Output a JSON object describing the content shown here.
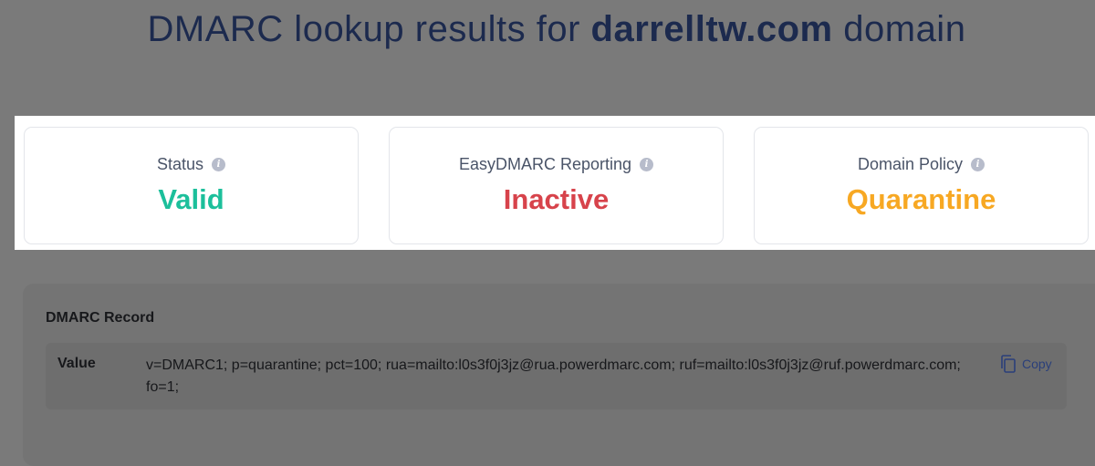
{
  "header": {
    "title_prefix": "DMARC lookup results for",
    "domain": "darrelltw.com",
    "title_suffix": "domain"
  },
  "cards": [
    {
      "label": "Status",
      "value": "Valid",
      "color": "#1cbf9b"
    },
    {
      "label": "EasyDMARC Reporting",
      "value": "Inactive",
      "color": "#d7434b"
    },
    {
      "label": "Domain Policy",
      "value": "Quarantine",
      "color": "#f7a823"
    }
  ],
  "record": {
    "title": "DMARC Record",
    "value_label": "Value",
    "value": "v=DMARC1; p=quarantine; pct=100; rua=mailto:l0s3f0j3jz@rua.powerdmarc.com; ruf=mailto:l0s3f0j3jz@ruf.powerdmarc.com; fo=1;",
    "copy_label": "Copy"
  },
  "icons": {
    "info": "info-icon",
    "copy": "copy-icon"
  }
}
